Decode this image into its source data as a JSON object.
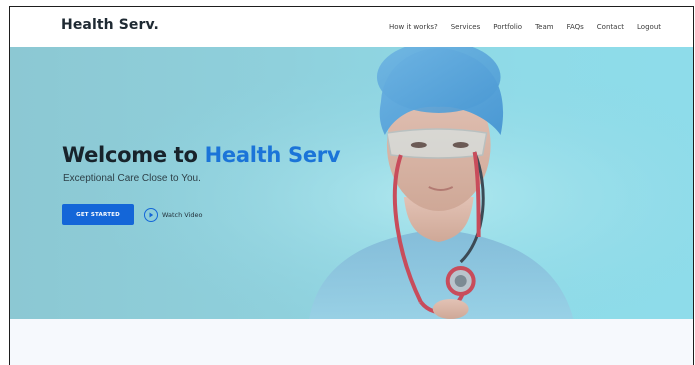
{
  "brand": "Health Serv.",
  "nav": {
    "items": [
      "How it works?",
      "Services",
      "Portfolio",
      "Team",
      "FAQs",
      "Contact",
      "Logout"
    ]
  },
  "hero": {
    "title_prefix": "Welcome to ",
    "title_accent": "Health Serv",
    "subtitle": "Exceptional Care Close to You.",
    "cta_label": "GET STARTED",
    "video_label": "Watch Video"
  },
  "icons": {
    "play": "play-circle-icon"
  },
  "colors": {
    "accent": "#1b74d8",
    "button": "#1466d8",
    "hero_bg": "#8fd0dc",
    "title_dark": "#18232b"
  }
}
